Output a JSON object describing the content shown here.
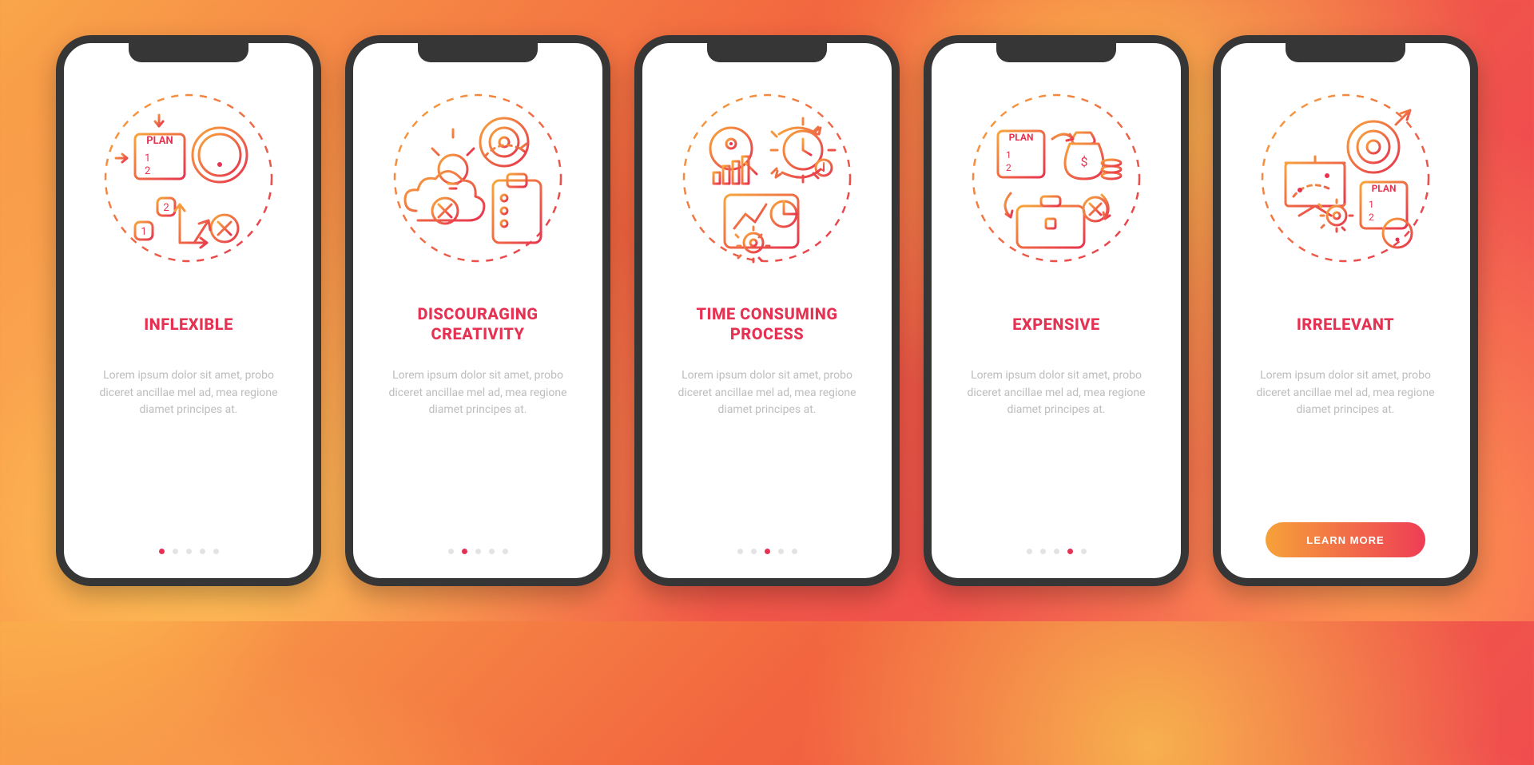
{
  "screens": [
    {
      "title": "INFLEXIBLE",
      "description": "Lorem ipsum dolor sit amet, probo diceret ancillae mel ad, mea regione diamet principes at.",
      "activeDot": 0,
      "hasButton": false
    },
    {
      "title": "DISCOURAGING CREATIVITY",
      "description": "Lorem ipsum dolor sit amet, probo diceret ancillae mel ad, mea regione diamet principes at.",
      "activeDot": 1,
      "hasButton": false
    },
    {
      "title": "TIME CONSUMING PROCESS",
      "description": "Lorem ipsum dolor sit amet, probo diceret ancillae mel ad, mea regione diamet principes at.",
      "activeDot": 2,
      "hasButton": false
    },
    {
      "title": "EXPENSIVE",
      "description": "Lorem ipsum dolor sit amet, probo diceret ancillae mel ad, mea regione diamet principes at.",
      "activeDot": 3,
      "hasButton": false
    },
    {
      "title": "IRRELEVANT",
      "description": "Lorem ipsum dolor sit amet, probo diceret ancillae mel ad, mea regione diamet principes at.",
      "activeDot": 4,
      "hasButton": true
    }
  ],
  "totalDots": 5,
  "button_label": "LEARN MORE",
  "colors": {
    "accent": "#e53152",
    "grad_a": "#f6a13a",
    "grad_b": "#ee3d55"
  }
}
